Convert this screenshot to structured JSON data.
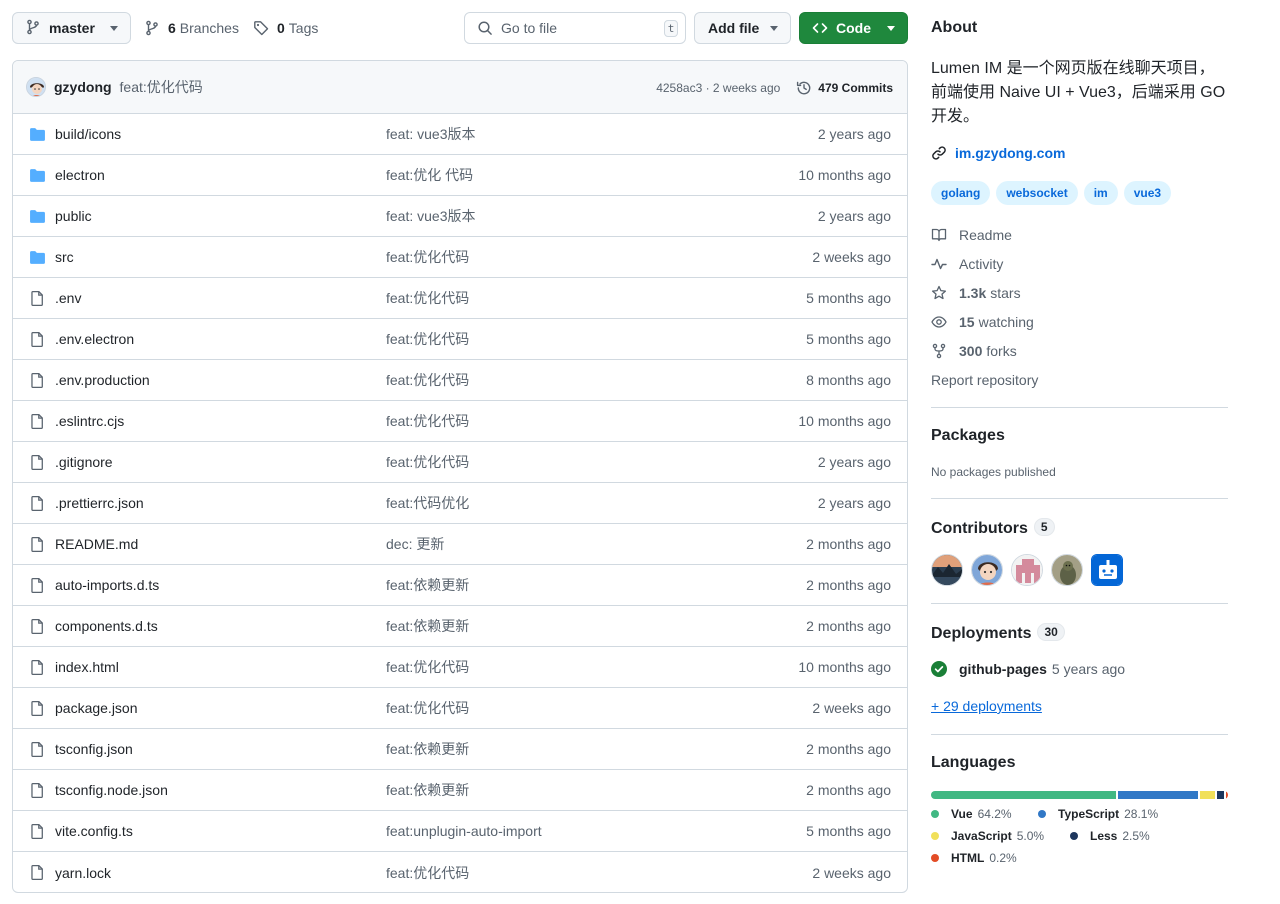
{
  "toolbar": {
    "branch": "master",
    "branches_count": "6",
    "branches_label": "Branches",
    "tags_count": "0",
    "tags_label": "Tags",
    "search_placeholder": "Go to file",
    "search_shortcut": "t",
    "add_file_label": "Add file",
    "code_label": "Code"
  },
  "latest_commit": {
    "author": "gzydong",
    "message": "feat:优化代码",
    "sha_time": "4258ac3 · 2 weeks ago",
    "commits_count": "479 Commits"
  },
  "files": [
    {
      "name": "build/icons",
      "type": "folder",
      "message": "feat: vue3版本",
      "age": "2 years ago"
    },
    {
      "name": "electron",
      "type": "folder",
      "message": "feat:优化 代码",
      "age": "10 months ago"
    },
    {
      "name": "public",
      "type": "folder",
      "message": "feat: vue3版本",
      "age": "2 years ago"
    },
    {
      "name": "src",
      "type": "folder",
      "message": "feat:优化代码",
      "age": "2 weeks ago"
    },
    {
      "name": ".env",
      "type": "file",
      "message": "feat:优化代码",
      "age": "5 months ago"
    },
    {
      "name": ".env.electron",
      "type": "file",
      "message": "feat:优化代码",
      "age": "5 months ago"
    },
    {
      "name": ".env.production",
      "type": "file",
      "message": "feat:优化代码",
      "age": "8 months ago"
    },
    {
      "name": ".eslintrc.cjs",
      "type": "file",
      "message": "feat:优化代码",
      "age": "10 months ago"
    },
    {
      "name": ".gitignore",
      "type": "file",
      "message": "feat:优化代码",
      "age": "2 years ago"
    },
    {
      "name": ".prettierrc.json",
      "type": "file",
      "message": "feat:代码优化",
      "age": "2 years ago"
    },
    {
      "name": "README.md",
      "type": "file",
      "message": "dec: 更新",
      "age": "2 months ago"
    },
    {
      "name": "auto-imports.d.ts",
      "type": "file",
      "message": "feat:依赖更新",
      "age": "2 months ago"
    },
    {
      "name": "components.d.ts",
      "type": "file",
      "message": "feat:依赖更新",
      "age": "2 months ago"
    },
    {
      "name": "index.html",
      "type": "file",
      "message": "feat:优化代码",
      "age": "10 months ago"
    },
    {
      "name": "package.json",
      "type": "file",
      "message": "feat:优化代码",
      "age": "2 weeks ago"
    },
    {
      "name": "tsconfig.json",
      "type": "file",
      "message": "feat:依赖更新",
      "age": "2 months ago"
    },
    {
      "name": "tsconfig.node.json",
      "type": "file",
      "message": "feat:依赖更新",
      "age": "2 months ago"
    },
    {
      "name": "vite.config.ts",
      "type": "file",
      "message": "feat:unplugin-auto-import",
      "age": "5 months ago"
    },
    {
      "name": "yarn.lock",
      "type": "file",
      "message": "feat:优化代码",
      "age": "2 weeks ago"
    }
  ],
  "about": {
    "title": "About",
    "description": "Lumen IM 是一个网页版在线聊天项目，前端使用 Naive UI + Vue3，后端采用 GO 开发。",
    "website": "im.gzydong.com",
    "topics": [
      "golang",
      "websocket",
      "im",
      "vue3"
    ],
    "readme": "Readme",
    "activity": "Activity",
    "stars_count": "1.3k",
    "stars_label": "stars",
    "watching_count": "15",
    "watching_label": "watching",
    "forks_count": "300",
    "forks_label": "forks",
    "report": "Report repository"
  },
  "packages": {
    "title": "Packages",
    "empty": "No packages published"
  },
  "contributors": {
    "title": "Contributors",
    "count": "5"
  },
  "deployments": {
    "title": "Deployments",
    "count": "30",
    "env": "github-pages",
    "when": "5 years ago",
    "more": "+ 29 deployments"
  },
  "languages": {
    "title": "Languages",
    "items": [
      {
        "name": "Vue",
        "percent": "64.2%",
        "value": 64.2,
        "color": "#41b883"
      },
      {
        "name": "TypeScript",
        "percent": "28.1%",
        "value": 28.1,
        "color": "#3178c6"
      },
      {
        "name": "JavaScript",
        "percent": "5.0%",
        "value": 5.0,
        "color": "#f1e05a"
      },
      {
        "name": "Less",
        "percent": "2.5%",
        "value": 2.5,
        "color": "#1d365d"
      },
      {
        "name": "HTML",
        "percent": "0.2%",
        "value": 0.2,
        "color": "#e34c26"
      }
    ]
  },
  "colors": {
    "accent": "#0969da",
    "code_button": "#1f883d",
    "folder": "#54aeff"
  }
}
